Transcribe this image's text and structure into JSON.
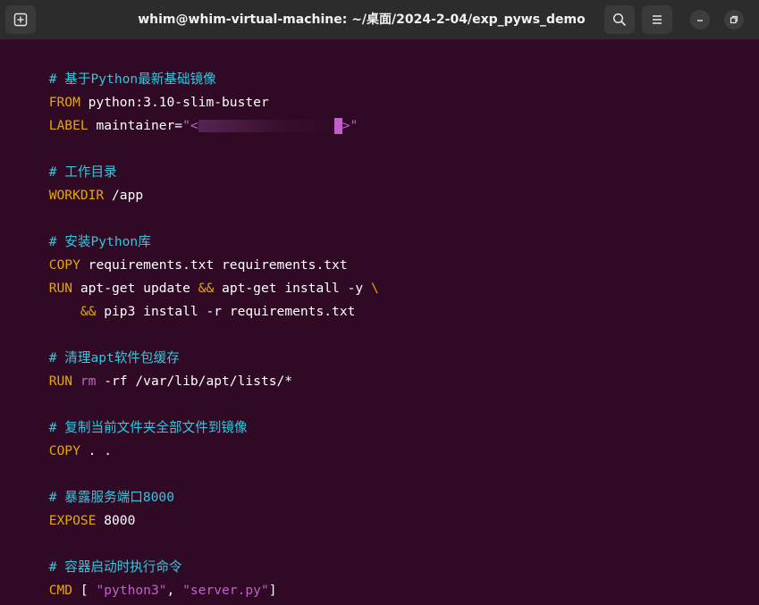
{
  "window": {
    "title": "whim@whim-virtual-machine: ~/桌面/2024-2-04/exp_pyws_demo",
    "bg_color": "#300a24",
    "titlebar_color": "#2c2c2c"
  },
  "icons": {
    "new_tab": "new-tab-icon",
    "search": "search-icon",
    "menu": "hamburger-menu-icon",
    "minimize": "minimize-icon",
    "restore": "restore-icon"
  },
  "colors": {
    "comment": "#33c7de",
    "keyword": "#e5a50a",
    "string": "#c061cb",
    "text": "#ffffff"
  },
  "dockerfile": {
    "c1": "# 基于Python最新基础镜像",
    "l2_kw": "FROM",
    "l2_rest": " python:3.10-slim-buster",
    "l3_kw": "LABEL",
    "l3_rest": " maintainer=",
    "l3_str_open": "\"<",
    "l3_str_close": ">\"",
    "c2": "# 工作目录",
    "l5_kw": "WORKDIR",
    "l5_rest": " /app",
    "c3": "# 安装Python库",
    "l7_kw": "COPY",
    "l7_rest": " requirements.txt requirements.txt",
    "l8_kw": "RUN",
    "l8_rest": " apt-get update ",
    "l8_op": "&&",
    "l8_rest2": " apt-get install -y ",
    "l8_cont": "\\",
    "l9_indent": "    ",
    "l9_op": "&&",
    "l9_rest": " pip3 install -r requirements.txt",
    "c4": "# 清理apt软件包缓存",
    "l11_kw": "RUN",
    "l11_rm": " rm",
    "l11_rest": " -rf /var/lib/apt/lists/*",
    "c5": "# 复制当前文件夹全部文件到镜像",
    "l13_kw": "COPY",
    "l13_rest": " . .",
    "c6": "# 暴露服务端口8000",
    "l15_kw": "EXPOSE",
    "l15_rest": " 8000",
    "c7": "# 容器启动时执行命令",
    "l17_kw": "CMD",
    "l17_a": " [ ",
    "l17_s1": "\"python3\"",
    "l17_b": ", ",
    "l17_s2": "\"server.py\"",
    "l17_c": "]"
  }
}
